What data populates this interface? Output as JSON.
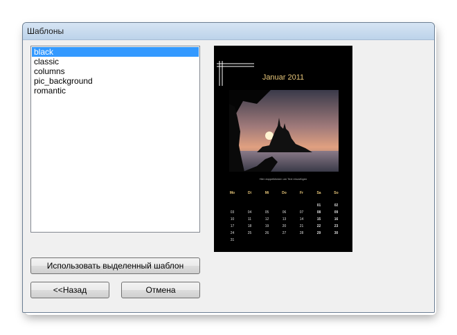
{
  "window": {
    "title": "Шаблоны"
  },
  "templates": {
    "items": [
      "black",
      "classic",
      "columns",
      "pic_background",
      "romantic"
    ],
    "selected_index": 0
  },
  "preview": {
    "month_title": "Januar 2011",
    "caption": "Hier doppelklicken um Text einzufügen",
    "weekdays": [
      "Mo",
      "Di",
      "Mi",
      "Do",
      "Fr",
      "Sa",
      "So"
    ],
    "weeks": [
      [
        "",
        "",
        "",
        "",
        "",
        "01",
        "02"
      ],
      [
        "03",
        "04",
        "05",
        "06",
        "07",
        "08",
        "09"
      ],
      [
        "10",
        "11",
        "12",
        "13",
        "14",
        "15",
        "16"
      ],
      [
        "17",
        "18",
        "19",
        "20",
        "21",
        "22",
        "23"
      ],
      [
        "24",
        "25",
        "26",
        "27",
        "28",
        "29",
        "30"
      ],
      [
        "31",
        "",
        "",
        "",
        "",
        "",
        ""
      ]
    ]
  },
  "buttons": {
    "use_selected": "Использовать выделенный шаблон",
    "back": "<<Назад",
    "cancel": "Отмена"
  }
}
